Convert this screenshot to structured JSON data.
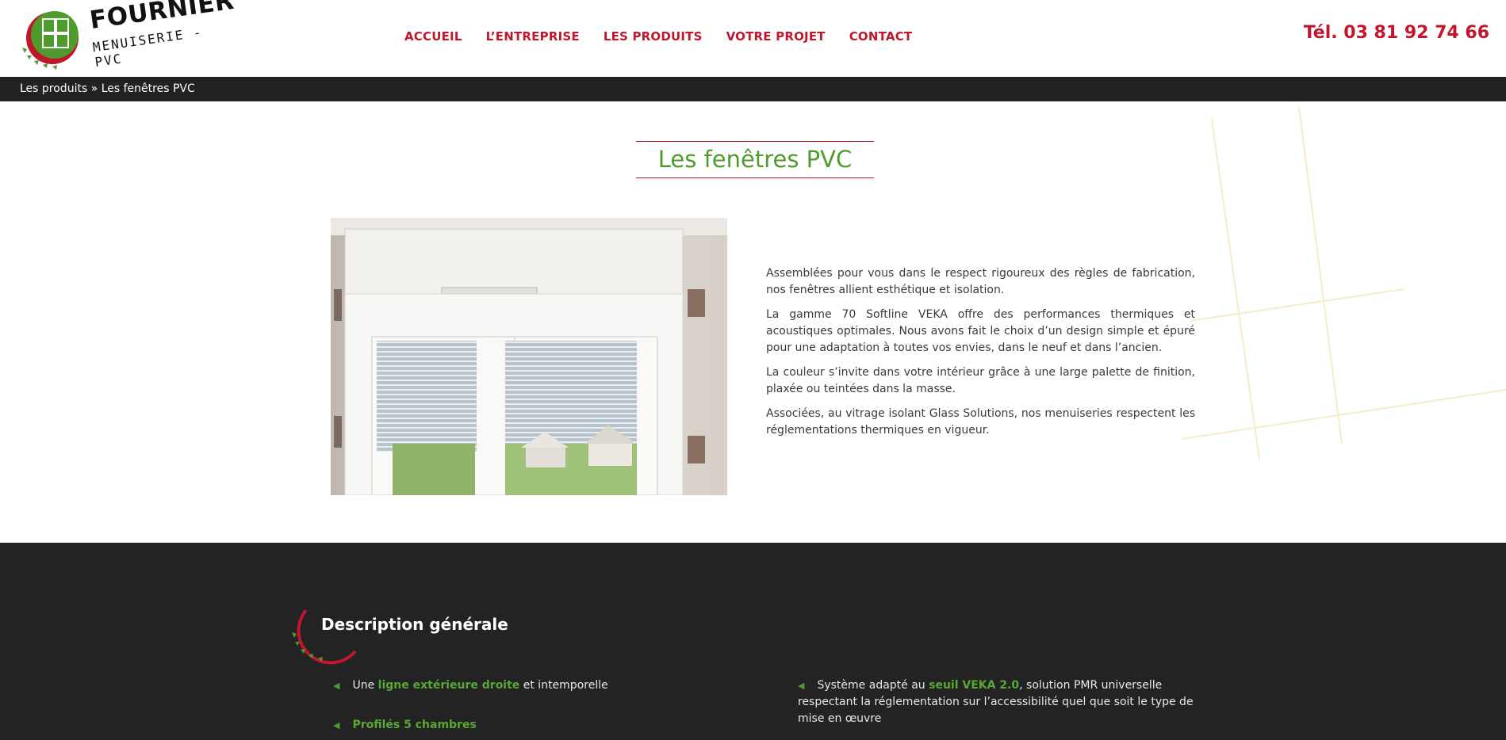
{
  "brand": {
    "name": "FOURNIER",
    "tagline": "MENUISERIE - PVC",
    "accent_red": "#c0172c",
    "accent_green": "#4e9b2e"
  },
  "nav": {
    "items": [
      {
        "label": "ACCUEIL"
      },
      {
        "label": "L’ENTREPRISE"
      },
      {
        "label": "LES PRODUITS"
      },
      {
        "label": "VOTRE PROJET"
      },
      {
        "label": "CONTACT"
      }
    ]
  },
  "header": {
    "phone": "Tél. 03 81 92 74 66"
  },
  "breadcrumb": {
    "text": "Les produits » Les fenêtres PVC"
  },
  "main": {
    "title": "Les fenêtres PVC",
    "paragraphs": [
      "Assemblées pour vous dans le respect rigoureux des règles de fabrication, nos fenêtres allient esthétique et isolation.",
      "La gamme 70 Softline VEKA offre des performances thermiques et acoustiques optimales. Nous avons fait le choix d’un design simple et épuré pour une adaptation à toutes vos envies, dans le neuf et dans l’ancien.",
      "La couleur s’invite dans votre intérieur grâce à une large palette de finition, plaxée ou teintées dans la masse.",
      "Associées, au vitrage isolant Glass Solutions, nos menuiseries respectent les réglementations thermiques en vigueur."
    ]
  },
  "description": {
    "title": "Description générale",
    "features": [
      {
        "pre": "Une ",
        "hl": "ligne extérieure droite",
        "post": " et intemporelle"
      },
      {
        "pre": "",
        "hl": "Profilés 5 chambres",
        "post": ""
      },
      {
        "pre": "Système adapté au ",
        "hl": "seuil VEKA 2.0",
        "post": ", solution PMR universelle respectant la réglementation sur l’accessibilité quel que soit le type de mise en œuvre"
      }
    ]
  }
}
